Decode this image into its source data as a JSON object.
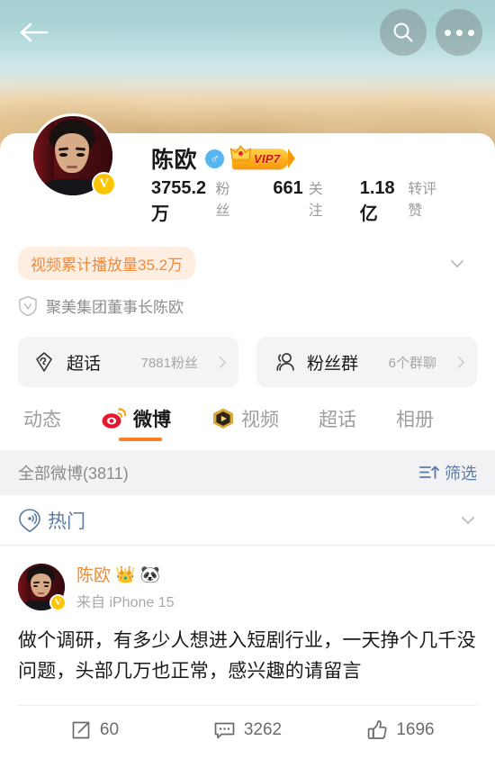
{
  "header": {
    "back_icon": "back-arrow-icon",
    "search_icon": "search-icon",
    "more_icon": "more-dots-icon"
  },
  "profile": {
    "username": "陈欧",
    "gender_symbol": "♂",
    "vip_label": "VIP7",
    "verified_badge": "V",
    "stats": [
      {
        "num": "3755.2万",
        "label": "粉丝"
      },
      {
        "num": "661",
        "label": "关注"
      },
      {
        "num": "1.18亿",
        "label": "转评赞"
      }
    ],
    "play_count_pill": "视频累计播放量35.2万",
    "bio": "聚美集团董事长陈欧",
    "expand_icon": "chevron-down-icon",
    "chips": [
      {
        "icon": "diamond-icon",
        "title": "超话",
        "sub": "7881粉丝"
      },
      {
        "icon": "users-icon",
        "title": "粉丝群",
        "sub": "6个群聊"
      }
    ]
  },
  "tabs": [
    {
      "label": "动态",
      "icon": null,
      "active": false
    },
    {
      "label": "微博",
      "icon": "weibo-eye-icon",
      "active": true
    },
    {
      "label": "视频",
      "icon": "video-hexagon-icon",
      "active": false
    },
    {
      "label": "超话",
      "icon": null,
      "active": false
    },
    {
      "label": "相册",
      "icon": null,
      "active": false
    }
  ],
  "filter_bar": {
    "title": "全部微博(3811)",
    "filter_label": "筛选",
    "filter_icon": "sort-filter-icon"
  },
  "hot_section": {
    "label": "热门",
    "icon": "hot-ripple-icon",
    "collapse_icon": "chevron-down-icon"
  },
  "post": {
    "author": "陈欧",
    "badges": [
      "👑",
      "🐼"
    ],
    "source": "来自 iPhone 15",
    "verified_badge": "V",
    "text": "做个调研，有多少人想进入短剧行业，一天挣个几千没问题，头部几万也正常，感兴趣的请留言",
    "actions": [
      {
        "icon": "share-icon",
        "count": "60"
      },
      {
        "icon": "comment-icon",
        "count": "3262"
      },
      {
        "icon": "like-thumb-icon",
        "count": "1696"
      }
    ]
  },
  "colors": {
    "accent_orange": "#fc7e22",
    "vip_gold": "#ffb01f",
    "verified_yellow": "#fdc500",
    "link_blue": "#5b7ba6",
    "weibo_red": "#e6162d",
    "cover_teal": "#a8cfd2",
    "cover_sand": "#e3c28c"
  }
}
